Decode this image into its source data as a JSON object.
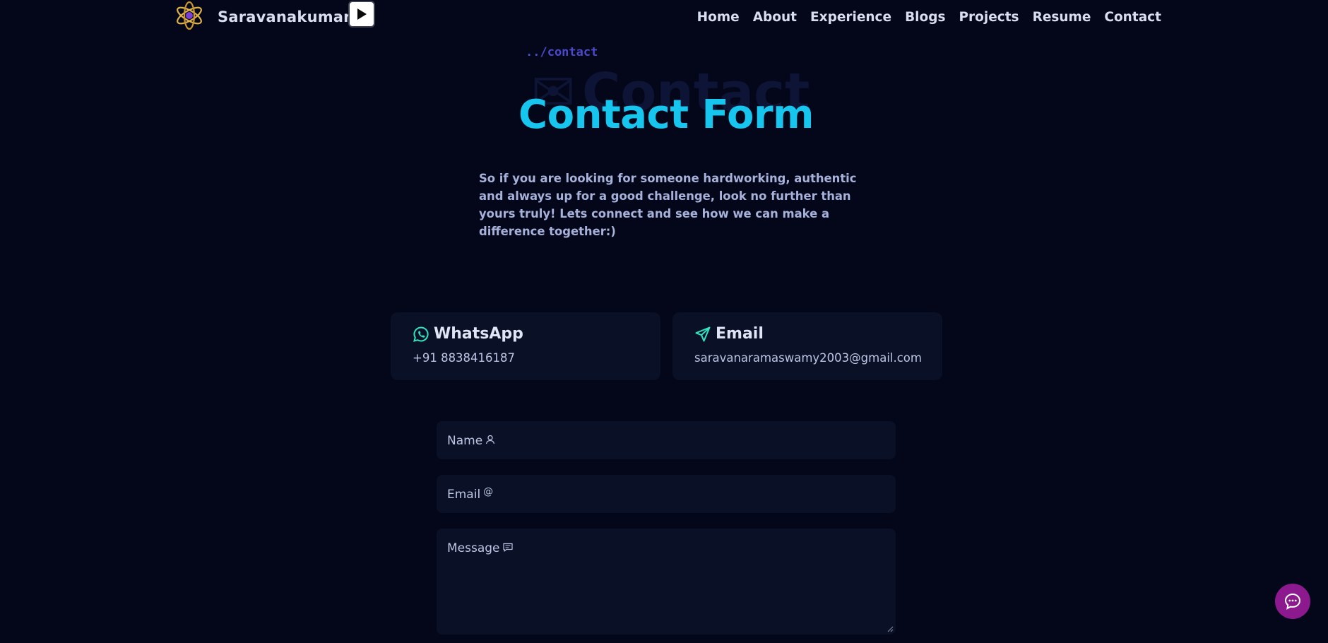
{
  "nav": {
    "brand": "Saravanakumar",
    "links": [
      "Home",
      "About",
      "Experience",
      "Blogs",
      "Projects",
      "Resume",
      "Contact"
    ]
  },
  "hero": {
    "breadcrumb": "../contact",
    "ghost_text": "Contact",
    "title": "Contact Form",
    "blurb": "So if you are looking for someone hardworking, authentic and always up for a good challenge, look no further than yours truly! Lets connect and see how we can make a difference together:)"
  },
  "cards": {
    "whatsapp": {
      "label": "WhatsApp",
      "value": "+91 8838416187"
    },
    "email": {
      "label": "Email",
      "value": "saravanaramaswamy2003@gmail.com"
    }
  },
  "form": {
    "name_label": "Name",
    "email_label": "Email",
    "email_symbol": "@",
    "message_label": "Message"
  },
  "colors": {
    "background": "#04071a",
    "accent": "#16c6ee",
    "card": "#0a1025",
    "chat_button": "#8c1a8e"
  }
}
